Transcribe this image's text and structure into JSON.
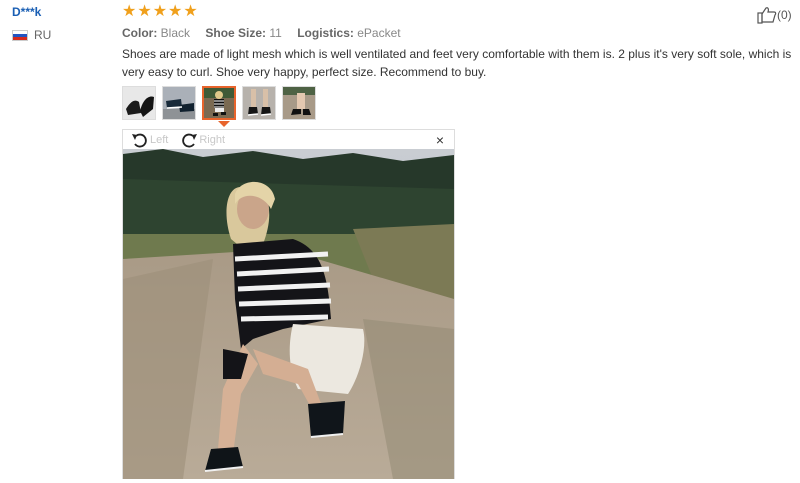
{
  "user": {
    "name": "D***k",
    "country": "RU"
  },
  "rating": {
    "stars": 5
  },
  "meta": {
    "color_label": "Color:",
    "color_value": "Black",
    "size_label": "Shoe Size:",
    "size_value": "11",
    "logistics_label": "Logistics:",
    "logistics_value": "ePacket"
  },
  "review": {
    "text": "Shoes are made of light mesh which is well ventilated and feet very comfortable with them is. 2 plus it's very soft sole, which is very easy to curl. Shoe very happy, perfect size. Recommend to buy."
  },
  "thumbnails": {
    "count": 5,
    "active_index": 2
  },
  "viewer": {
    "left_label": "Left",
    "right_label": "Right",
    "close_label": "×"
  },
  "helpful": {
    "count": "(0)"
  },
  "icons": {
    "like": "thumbs-up-icon",
    "rotate_left": "rotate-left-icon",
    "rotate_right": "rotate-right-icon",
    "close": "close-icon"
  },
  "colors": {
    "username": "#1a5fb4",
    "star": "#f0a01c",
    "active_border": "#e8642c"
  }
}
